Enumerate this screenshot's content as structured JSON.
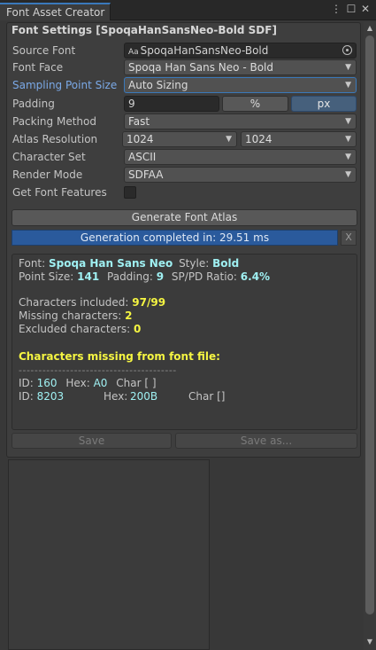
{
  "tab": {
    "title": "Font Asset Creator"
  },
  "window_controls": {
    "menu": "⋮",
    "maximize": "☐",
    "close": "✕"
  },
  "header": "Font Settings [SpoqaHanSansNeo-Bold SDF]",
  "labels": {
    "source_font": "Source Font",
    "font_face": "Font Face",
    "sampling_point_size": "Sampling Point Size",
    "padding": "Padding",
    "packing_method": "Packing Method",
    "atlas_resolution": "Atlas Resolution",
    "character_set": "Character Set",
    "render_mode": "Render Mode",
    "get_font_features": "Get Font Features"
  },
  "values": {
    "source_font": "SpoqaHanSansNeo-Bold",
    "source_font_icon": "Aa",
    "font_face": "Spoqa Han Sans Neo - Bold",
    "sampling_point_size": "Auto Sizing",
    "padding": "9",
    "padding_unit_percent": "%",
    "padding_unit_px": "px",
    "packing_method": "Fast",
    "atlas_width": "1024",
    "atlas_height": "1024",
    "character_set": "ASCII",
    "render_mode": "SDFAA",
    "get_font_features": false
  },
  "generate_button": "Generate Font Atlas",
  "progress": {
    "text": "Generation completed in: 29.51 ms",
    "fraction": 1.0,
    "cancel": "X"
  },
  "info": {
    "font_label": "Font:",
    "font_value": "Spoqa Han Sans Neo",
    "style_label": "Style:",
    "style_value": "Bold",
    "point_size_label": "Point Size:",
    "point_size_value": "141",
    "padding_label": "Padding:",
    "padding_value": "9",
    "ratio_label": "SP/PD Ratio:",
    "ratio_value": "6.4%",
    "chars_included_label": "Characters included:",
    "chars_included_value": "97/99",
    "missing_label": "Missing characters:",
    "missing_value": "2",
    "excluded_label": "Excluded characters:",
    "excluded_value": "0",
    "missing_header": "Characters missing from font file:",
    "divider": "----------------------------------------",
    "rows": [
      {
        "id_label": "ID:",
        "id": "160",
        "hex_label": "Hex:",
        "hex": "A0",
        "char": "Char [ ]"
      },
      {
        "id_label": "ID:",
        "id": "8203",
        "hex_label": "Hex:",
        "hex": "200B",
        "char": "Char []"
      }
    ]
  },
  "save_button": "Save",
  "save_as_button": "Save as..."
}
